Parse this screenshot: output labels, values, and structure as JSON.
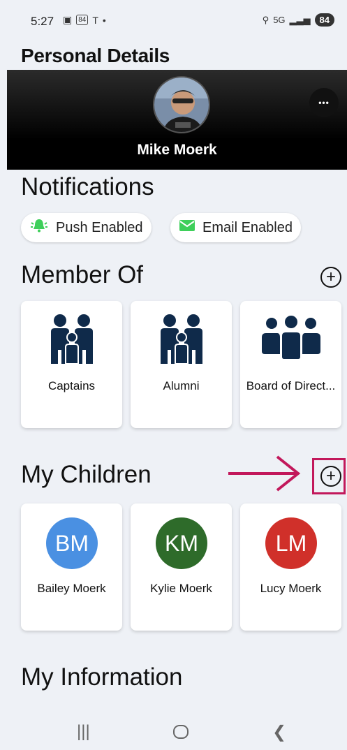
{
  "status": {
    "time": "5:27",
    "badge": "84",
    "network": "5G",
    "battery": "84"
  },
  "page_title": "Personal Details",
  "profile": {
    "name": "Mike Moerk",
    "more_label": "•••"
  },
  "notifications": {
    "title": "Notifications",
    "chips": [
      {
        "label": "Push Enabled",
        "icon": "bell-icon",
        "color": "#3ecf5a"
      },
      {
        "label": "Email Enabled",
        "icon": "mail-icon",
        "color": "#3ecf5a"
      }
    ]
  },
  "member_of": {
    "title": "Member Of",
    "add_label": "+",
    "groups": [
      {
        "label": "Captains",
        "icon": "family-icon"
      },
      {
        "label": "Alumni",
        "icon": "family-icon"
      },
      {
        "label": "Board of Direct...",
        "icon": "group-icon"
      }
    ]
  },
  "children": {
    "title": "My Children",
    "add_label": "+",
    "items": [
      {
        "initials": "BM",
        "name": "Bailey Moerk",
        "color": "#4a90e2"
      },
      {
        "initials": "KM",
        "name": "Kylie Moerk",
        "color": "#2e6b2a"
      },
      {
        "initials": "LM",
        "name": "Lucy Moerk",
        "color": "#d0302a"
      }
    ]
  },
  "my_information": {
    "title": "My Information"
  },
  "colors": {
    "icon_navy": "#0f2a4a",
    "highlight": "#c2185b"
  }
}
